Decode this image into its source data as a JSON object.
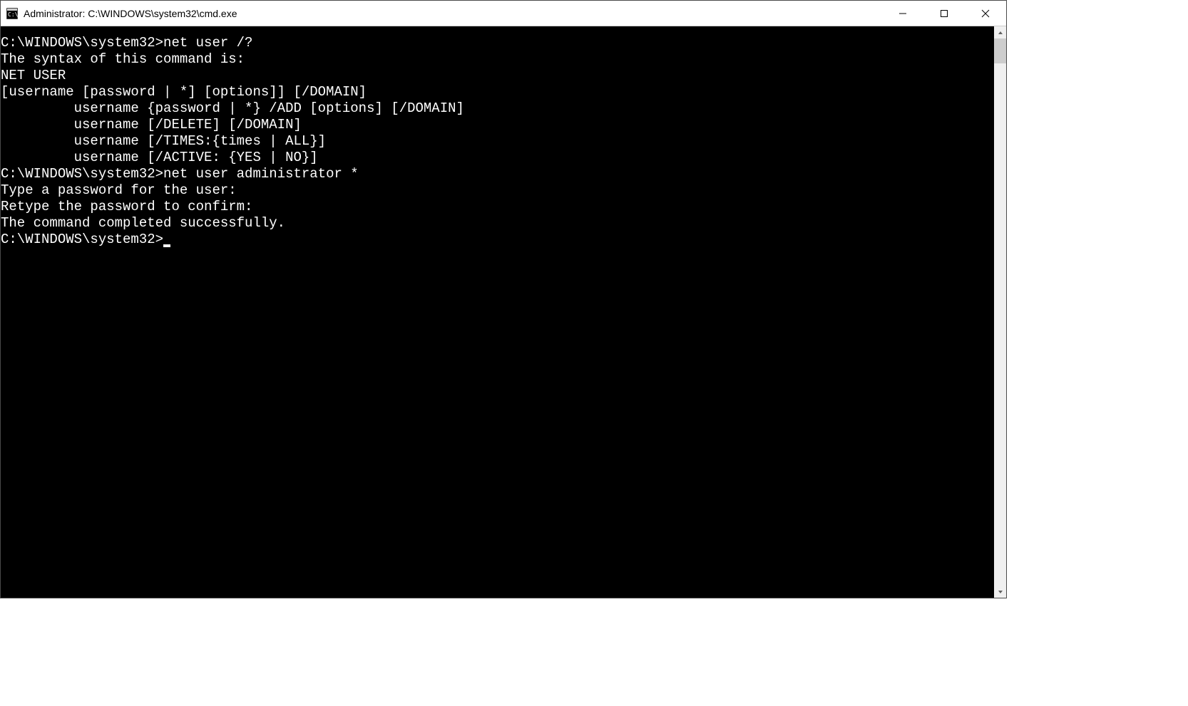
{
  "window": {
    "title": "Administrator: C:\\WINDOWS\\system32\\cmd.exe"
  },
  "terminal": {
    "lines": [
      "",
      "C:\\WINDOWS\\system32>net user /?",
      "The syntax of this command is:",
      "",
      "NET USER",
      "[username [password | *] [options]] [/DOMAIN]",
      "         username {password | *} /ADD [options] [/DOMAIN]",
      "         username [/DELETE] [/DOMAIN]",
      "         username [/TIMES:{times | ALL}]",
      "         username [/ACTIVE: {YES | NO}]",
      "",
      "",
      "C:\\WINDOWS\\system32>net user administrator *",
      "Type a password for the user:",
      "Retype the password to confirm:",
      "The command completed successfully.",
      "",
      ""
    ],
    "current_prompt": "C:\\WINDOWS\\system32>"
  }
}
